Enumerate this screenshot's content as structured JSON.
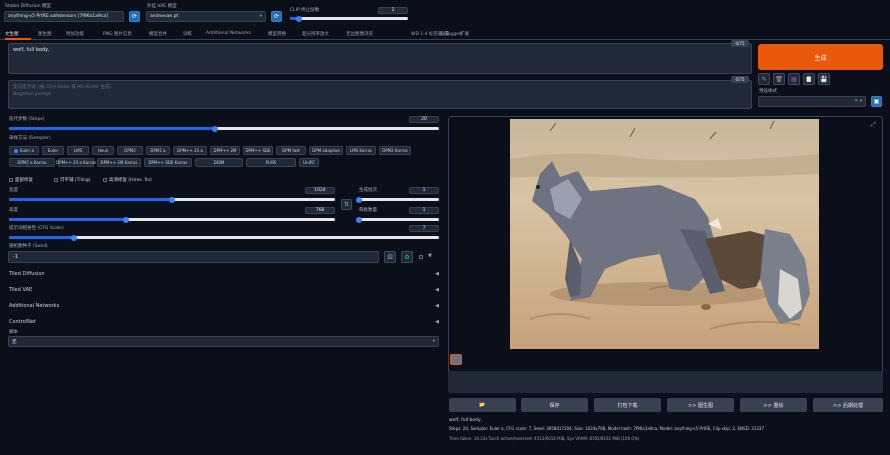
{
  "top": {
    "ckpt_label": "Stable Diffusion 模型",
    "ckpt_value": "anything-v5-PrtRE.safetensors [7f96a1a9ca]",
    "vae_label": "外挂 VAE 模型",
    "vae_value": "animevae.pt",
    "clip_label": "CLIP 终止层数",
    "clip_value": "2",
    "clip_fraction": 0.08
  },
  "tabs": [
    "文生图",
    "图生图",
    "附加功能",
    "PNG 图片信息",
    "模型合并",
    "训练",
    "Additional Networks",
    "模型转换",
    "超分辨率放大",
    "无边图像浏览",
    "WD 1.4 标签器 (Tagger)",
    "设置",
    "扩展"
  ],
  "prompt": {
    "positive": "wolf, full body,",
    "positive_count": "0/75",
    "negative": "反向提示词（按 Ctrl+Enter 或 Alt+Enter 生成）\nNegative prompt",
    "negative_count": "0/75"
  },
  "generate": {
    "label": "生成",
    "style_label": "预设样式",
    "tool_icons": [
      "pencil-icon",
      "trash-icon",
      "image-icon",
      "clipboard-icon",
      "save-icon"
    ]
  },
  "params": {
    "steps_label": "迭代步数 (Steps)",
    "steps_value": "20",
    "steps_fraction": 0.48,
    "sampler_label": "采样方法 (Sampler)",
    "samplers": [
      "Euler a",
      "Euler",
      "LMS",
      "Heun",
      "DPM2",
      "DPM2 a",
      "DPM++ 2S a",
      "DPM++ 2M",
      "DPM++ SDE",
      "DPM fast",
      "DPM adaptive",
      "LMS Karras",
      "DPM2 Karras",
      "DPM2 a Karras",
      "DPM++ 2S a Karras",
      "DPM++ 2M Karras",
      "DPM++ SDE Karras",
      "DDIM",
      "PLMS",
      "UniPC"
    ],
    "selected_sampler": "Euler a",
    "checkboxes": [
      "面部修复",
      "可平铺 (Tiling)",
      "高清修复 (Hires. fix)"
    ],
    "width_label": "宽度",
    "width_value": "1024",
    "width_fraction": 0.5,
    "height_label": "高度",
    "height_value": "768",
    "height_fraction": 0.36,
    "swap_icon": "swap-icon",
    "batch_count_label": "生成批次",
    "batch_count_value": "1",
    "batch_count_fraction": 0.0,
    "batch_size_label": "每批数量",
    "batch_size_value": "1",
    "batch_size_fraction": 0.0,
    "cfg_label": "提示词相关性 (CFG Scale)",
    "cfg_value": "7",
    "cfg_fraction": 0.15,
    "seed_label": "随机数种子 (Seed)",
    "seed_value": "-1",
    "accordions": [
      "Tiled Diffusion",
      "Tiled VAE",
      "Additional Networks",
      "ControlNet"
    ],
    "script_label": "脚本",
    "script_value": "无"
  },
  "output": {
    "image_alt": "wolf",
    "buttons": [
      "📂",
      "保存",
      "打包下载",
      ">> 图生图",
      ">> 重绘",
      ">> 后期处理"
    ],
    "info_line1": "wolf, full body,",
    "info_line2": "Steps: 20, Sampler: Euler a, CFG scale: 7, Seed: 3958417204, Size: 1024x768, Model hash: 7f96a1a9ca, Model: anything-v5-PrtRE, Clip skip: 2, ENSD: 31337",
    "info_line3": "Time taken: 14.23s  Torch active/reserved: 4513/6018 MiB, Sys VRAM: 8192/8192 MiB (100.0%)"
  },
  "colors": {
    "accent": "#e8590c",
    "bg": "#0b0f19",
    "panel": "#1f2937",
    "slider": "#2563eb"
  }
}
